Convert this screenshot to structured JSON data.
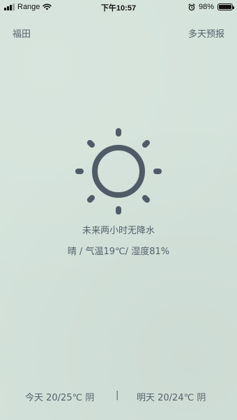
{
  "status_bar": {
    "carrier": "Range",
    "time": "下午10:57",
    "battery_percent": "98%",
    "battery_level": 0.98,
    "icons": [
      "signal-icon",
      "wifi-icon",
      "alarm-icon",
      "battery-icon"
    ]
  },
  "header": {
    "city": "福田",
    "forecast_link": "多天预报"
  },
  "current": {
    "icon": "sun-icon",
    "precipitation": "未来两小时无降水",
    "detail": "晴 / 气温19℃/ 湿度81%"
  },
  "footer": {
    "today": "今天 20/25℃ 阴",
    "separator": "|",
    "tomorrow": "明天 20/24℃ 阴"
  },
  "colors": {
    "background": "#d3e2da",
    "icon": "#4f5b66",
    "text": "#55616b"
  }
}
